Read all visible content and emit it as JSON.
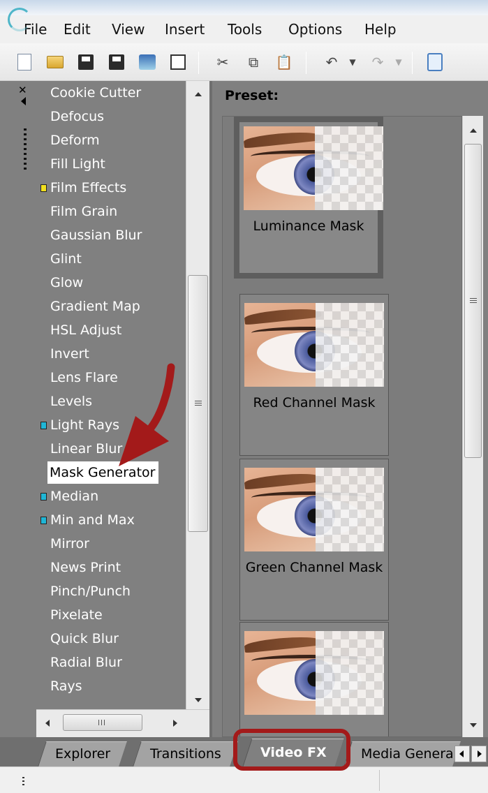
{
  "menubar": {
    "items": [
      "File",
      "Edit",
      "View",
      "Insert",
      "Tools",
      "Options",
      "Help"
    ]
  },
  "toolbar": {
    "icons": [
      "new-document-icon",
      "open-folder-icon",
      "save-icon",
      "save-as-icon",
      "render-as-icon",
      "properties-icon",
      "cut-icon",
      "copy-icon",
      "paste-icon",
      "undo-icon",
      "dropdown-icon",
      "redo-icon",
      "dropdown-icon",
      "normal-edit-tool-icon"
    ]
  },
  "fx_list": {
    "items": [
      {
        "label": "Cookie Cutter",
        "marker": null
      },
      {
        "label": "Defocus",
        "marker": null
      },
      {
        "label": "Deform",
        "marker": null
      },
      {
        "label": "Fill Light",
        "marker": null
      },
      {
        "label": "Film Effects",
        "marker": "#f2e01e"
      },
      {
        "label": "Film Grain",
        "marker": null
      },
      {
        "label": "Gaussian Blur",
        "marker": null
      },
      {
        "label": "Glint",
        "marker": null
      },
      {
        "label": "Glow",
        "marker": null
      },
      {
        "label": "Gradient Map",
        "marker": null
      },
      {
        "label": "HSL Adjust",
        "marker": null
      },
      {
        "label": "Invert",
        "marker": null
      },
      {
        "label": "Lens Flare",
        "marker": null
      },
      {
        "label": "Levels",
        "marker": null
      },
      {
        "label": "Light Rays",
        "marker": "#1fb6d6"
      },
      {
        "label": "Linear Blur",
        "marker": null
      },
      {
        "label": "Mask Generator",
        "marker": null
      },
      {
        "label": "Median",
        "marker": "#1fb6d6"
      },
      {
        "label": "Min and Max",
        "marker": "#1fb6d6"
      },
      {
        "label": "Mirror",
        "marker": null
      },
      {
        "label": "News Print",
        "marker": null
      },
      {
        "label": "Pinch/Punch",
        "marker": null
      },
      {
        "label": "Pixelate",
        "marker": null
      },
      {
        "label": "Quick Blur",
        "marker": null
      },
      {
        "label": "Radial Blur",
        "marker": null
      },
      {
        "label": "Rays",
        "marker": null
      }
    ],
    "selected": "Mask Generator"
  },
  "presets": {
    "label": "Preset:",
    "cards": [
      {
        "label": "Luminance Mask",
        "selected": true
      },
      {
        "label": "Red Channel Mask",
        "selected": false
      },
      {
        "label": "Green Channel Mask",
        "selected": false
      },
      {
        "label": "",
        "selected": false
      }
    ]
  },
  "tabs": {
    "items": [
      "Explorer",
      "Transitions",
      "Video FX",
      "Media Genera"
    ],
    "active": "Video FX"
  },
  "colors": {
    "annotation": "#a31a1a",
    "panel_bg": "#808080"
  }
}
